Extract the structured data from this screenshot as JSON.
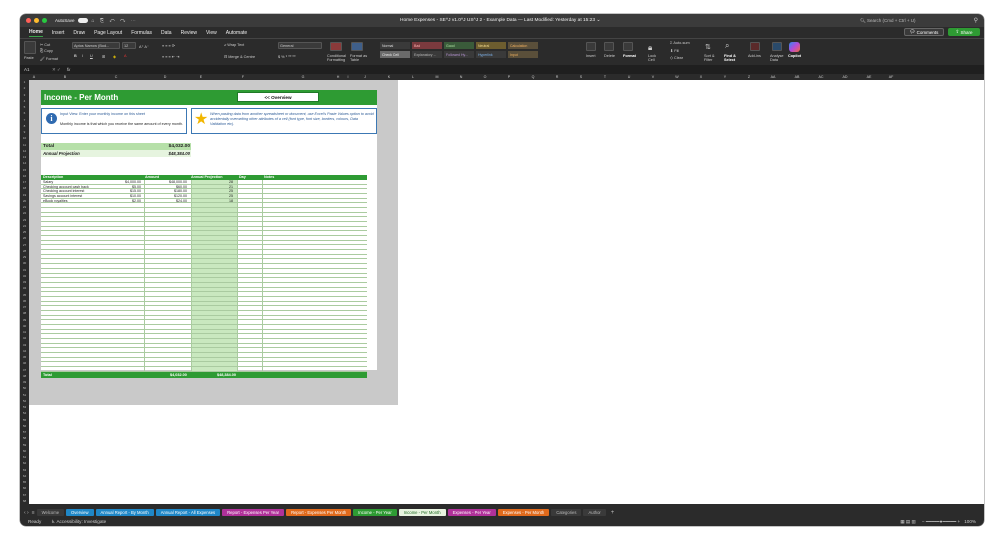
{
  "titlebar": {
    "autosave_label": "AutoSave",
    "title": "Home Expenses - SE^J v1.0^J US^J 2 - Example Data — Last Modified: Yesterday at 15:23 ⌄",
    "search_placeholder": "Search (Cmd + Ctrl + U)"
  },
  "menu": {
    "items": [
      "Home",
      "Insert",
      "Draw",
      "Page Layout",
      "Formulas",
      "Data",
      "Review",
      "View",
      "Automate"
    ],
    "comments_label": "Comments",
    "share_label": "Share"
  },
  "ribbon": {
    "paste": "Paste",
    "cut": "Cut",
    "copy": "Copy",
    "format": "Format",
    "font_name": "Aptos Narrow (Bod...",
    "font_size": "12",
    "wrap_text": "Wrap Text",
    "merge_center": "Merge & Centre",
    "number_format": "General",
    "conditional_formatting": "Conditional Formatting",
    "format_as_table": "Format as Table",
    "styles": [
      {
        "label": "Normal",
        "bg": "#3a3a3a",
        "fg": "#ddd"
      },
      {
        "label": "Bad",
        "bg": "#7a3a3e",
        "fg": "#ffb0b0"
      },
      {
        "label": "Good",
        "bg": "#3a5b3a",
        "fg": "#b4e6a8"
      },
      {
        "label": "Neutral",
        "bg": "#6d5d2f",
        "fg": "#f5dc8e"
      },
      {
        "label": "Calculation",
        "bg": "#5a4f3a",
        "fg": "#f0b060"
      },
      {
        "label": "Check Cell",
        "bg": "#6a6a6a",
        "fg": "#eee"
      },
      {
        "label": "Explanatory ...",
        "bg": "#3a3a3a",
        "fg": "#bbb"
      },
      {
        "label": "Followed Hy...",
        "bg": "#3a3a3a",
        "fg": "#b896d6"
      },
      {
        "label": "Hyperlink",
        "bg": "#3a3a3a",
        "fg": "#7eb2ea"
      },
      {
        "label": "Input",
        "bg": "#5a4f3a",
        "fg": "#f0b060"
      }
    ],
    "insert": "Insert",
    "delete": "Delete",
    "format_cells": "Format",
    "lock_cell": "Lock Cell",
    "autosum": "Auto-sum",
    "fill": "Fill",
    "clear": "Clear",
    "sort_filter": "Sort & Filter",
    "find_select": "Find & Select",
    "add_ins": "Add-ins",
    "analyse_data": "Analyse Data",
    "copilot": "Copilot"
  },
  "formula_bar": {
    "name_box": "A1",
    "fx": "fx"
  },
  "columns": [
    "A",
    "B",
    "C",
    "D",
    "E",
    "F",
    "G",
    "H",
    "I",
    "J",
    "K",
    "L",
    "M",
    "N",
    "O",
    "P",
    "Q",
    "R",
    "S",
    "T",
    "U",
    "V",
    "W",
    "X",
    "Y",
    "Z",
    "AA",
    "AB",
    "AC",
    "AD",
    "AE",
    "AF"
  ],
  "rows": [
    "1",
    "2",
    "3",
    "4",
    "5",
    "6",
    "7",
    "8",
    "9",
    "10",
    "11",
    "12",
    "13",
    "14",
    "15",
    "16",
    "17",
    "18",
    "19",
    "20",
    "21",
    "22",
    "23",
    "24",
    "25",
    "26",
    "27",
    "28",
    "29",
    "30",
    "31",
    "32",
    "33",
    "34",
    "35",
    "36",
    "37",
    "38",
    "39",
    "40",
    "41",
    "42",
    "43",
    "44",
    "45",
    "46",
    "47",
    "48",
    "49",
    "50",
    "51",
    "52",
    "53",
    "54",
    "55",
    "56",
    "57",
    "58",
    "59",
    "60",
    "61",
    "62",
    "63",
    "64",
    "65",
    "66",
    "67",
    "68"
  ],
  "sheet": {
    "title": "Income - Per Month",
    "overview_button": "<< Overview",
    "info_title": "Input View: Enter your monthly income on this sheet",
    "info_body": "Monthly income is that which you receive the same amount of every month.",
    "tip_text": "When pasting data from another spreadsheet or document, use Excel's Paste Values option to avoid accidentally overwriting other attributes of a cell (font type, font size, borders, colours, Data Validation etc).",
    "total_label": "Total",
    "total_value": "$4,032.00",
    "projection_label": "Annual Projection",
    "projection_value": "$48,384.00",
    "table_headers": [
      "Description",
      "Amount",
      "Annual Projection",
      "Day",
      "Notes"
    ],
    "table_rows": [
      [
        "Salary",
        "$4,000.00",
        "$48,000.00",
        "28",
        ""
      ],
      [
        "Checking account cash back",
        "$5.00",
        "$60.00",
        "21",
        ""
      ],
      [
        "Checking account interest",
        "$15.00",
        "$180.00",
        "25",
        ""
      ],
      [
        "Savings account interest",
        "$10.00",
        "$120.00",
        "25",
        ""
      ],
      [
        "eBook royalties",
        "$2.00",
        "$24.00",
        "18",
        ""
      ]
    ],
    "footer_label": "Total",
    "footer_amount": "$4,032.00",
    "footer_projection": "$48,384.00"
  },
  "tabs": [
    {
      "label": "Welcome",
      "bg": "#3a3a3a",
      "fg": "#bbb"
    },
    {
      "label": "Overview",
      "bg": "#1f87c7",
      "fg": "#fff"
    },
    {
      "label": "Annual Report - By Month",
      "bg": "#1f87c7",
      "fg": "#fff"
    },
    {
      "label": "Annual Report - All Expenses",
      "bg": "#1f87c7",
      "fg": "#fff"
    },
    {
      "label": "Report - Expenses Per Year",
      "bg": "#b0319a",
      "fg": "#fff"
    },
    {
      "label": "Report - Expenses Per Month",
      "bg": "#e06a1c",
      "fg": "#fff"
    },
    {
      "label": "Income - Per Year",
      "bg": "#2e9b33",
      "fg": "#fff"
    },
    {
      "label": "Income - Per Month",
      "bg": "#e8f4e0",
      "fg": "#1f6a22"
    },
    {
      "label": "Expenses - Per Year",
      "bg": "#b0319a",
      "fg": "#fff"
    },
    {
      "label": "Expenses - Per Month",
      "bg": "#e06a1c",
      "fg": "#fff"
    },
    {
      "label": "Categories",
      "bg": "#3a3a3a",
      "fg": "#bbb"
    },
    {
      "label": "Author",
      "bg": "#3a3a3a",
      "fg": "#bbb"
    }
  ],
  "status": {
    "ready": "Ready",
    "accessibility": "Accessibility: Investigate",
    "zoom": "100%"
  }
}
